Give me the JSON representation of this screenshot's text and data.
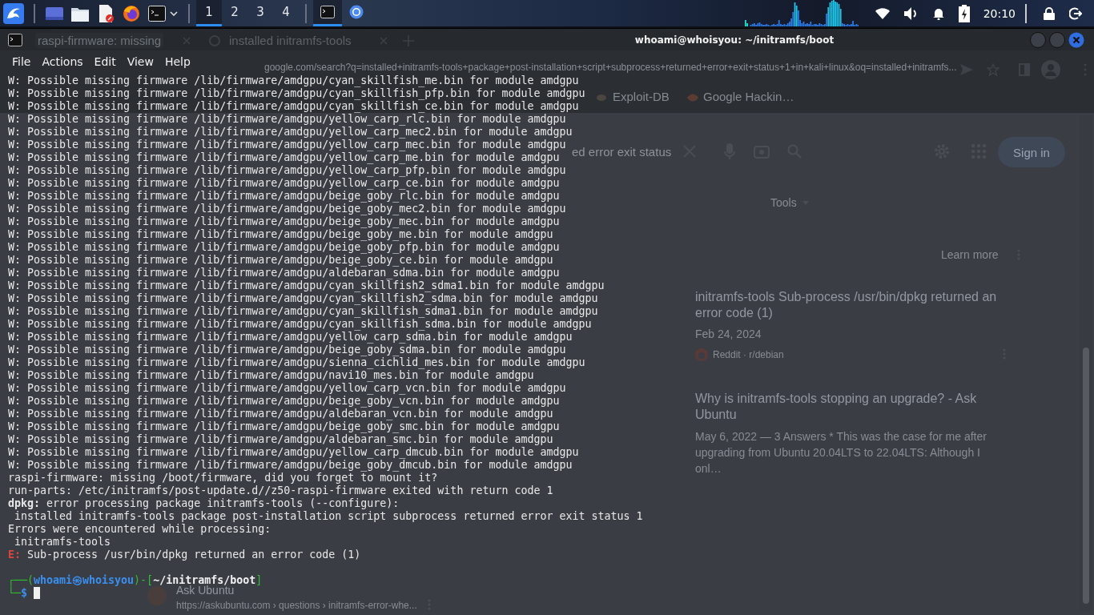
{
  "panel": {
    "workspaces": [
      {
        "label": "1",
        "selected": true
      },
      {
        "label": "2",
        "selected": false
      },
      {
        "label": "3",
        "selected": false
      },
      {
        "label": "4",
        "selected": false
      }
    ],
    "tasks": [
      {
        "kind": "terminal",
        "selected": true
      },
      {
        "kind": "browser",
        "selected": false
      }
    ],
    "clock": "20:10"
  },
  "background_browser": {
    "tabs": [
      {
        "label": "raspi-firmware: missing",
        "selected": true
      },
      {
        "label": "installed initramfs-tools",
        "selected": false
      }
    ],
    "address": "google.com/search?q=installed+initramfs-tools+package+post-installation+script+subprocess+returned+error+exit+status+1+in+kali+linux&oq=installed+initramfs...",
    "bookmarks": [
      "Exploit-DB",
      "Google Hackin…"
    ],
    "search_query": "ed error exit status",
    "sign_in": "Sign in",
    "tools": "Tools",
    "learn_more": "Learn more",
    "results": [
      {
        "title": "initramfs-tools Sub-process /usr/bin/dpkg returned an error code (1)",
        "date": "Feb 24, 2024",
        "source": "Reddit · r/debian"
      },
      {
        "title": "Why is initramfs-tools stopping an upgrade? - Ask Ubuntu",
        "snippet": "May 6, 2022 — 3 Answers * This was the case for me after upgrading from Ubuntu 20.04LTS to 22.04LTS: Although I onl…"
      }
    ],
    "bottom_result": {
      "site": "Ask Ubuntu",
      "url": "https://askubuntu.com › questions › initramfs-error-whe..."
    }
  },
  "terminal": {
    "title": "whoami@whoisyou: ~/initramfs/boot",
    "menu": [
      "File",
      "Actions",
      "Edit",
      "View",
      "Help"
    ],
    "lines": [
      {
        "kind": "plain",
        "text": "W: Possible missing firmware /lib/firmware/amdgpu/cyan_skillfish_me.bin for module amdgpu"
      },
      {
        "kind": "plain",
        "text": "W: Possible missing firmware /lib/firmware/amdgpu/cyan_skillfish_pfp.bin for module amdgpu"
      },
      {
        "kind": "plain",
        "text": "W: Possible missing firmware /lib/firmware/amdgpu/cyan_skillfish_ce.bin for module amdgpu"
      },
      {
        "kind": "plain",
        "text": "W: Possible missing firmware /lib/firmware/amdgpu/yellow_carp_rlc.bin for module amdgpu"
      },
      {
        "kind": "plain",
        "text": "W: Possible missing firmware /lib/firmware/amdgpu/yellow_carp_mec2.bin for module amdgpu"
      },
      {
        "kind": "plain",
        "text": "W: Possible missing firmware /lib/firmware/amdgpu/yellow_carp_mec.bin for module amdgpu"
      },
      {
        "kind": "plain",
        "text": "W: Possible missing firmware /lib/firmware/amdgpu/yellow_carp_me.bin for module amdgpu"
      },
      {
        "kind": "plain",
        "text": "W: Possible missing firmware /lib/firmware/amdgpu/yellow_carp_pfp.bin for module amdgpu"
      },
      {
        "kind": "plain",
        "text": "W: Possible missing firmware /lib/firmware/amdgpu/yellow_carp_ce.bin for module amdgpu"
      },
      {
        "kind": "plain",
        "text": "W: Possible missing firmware /lib/firmware/amdgpu/beige_goby_rlc.bin for module amdgpu"
      },
      {
        "kind": "plain",
        "text": "W: Possible missing firmware /lib/firmware/amdgpu/beige_goby_mec2.bin for module amdgpu"
      },
      {
        "kind": "plain",
        "text": "W: Possible missing firmware /lib/firmware/amdgpu/beige_goby_mec.bin for module amdgpu"
      },
      {
        "kind": "plain",
        "text": "W: Possible missing firmware /lib/firmware/amdgpu/beige_goby_me.bin for module amdgpu"
      },
      {
        "kind": "plain",
        "text": "W: Possible missing firmware /lib/firmware/amdgpu/beige_goby_pfp.bin for module amdgpu"
      },
      {
        "kind": "plain",
        "text": "W: Possible missing firmware /lib/firmware/amdgpu/beige_goby_ce.bin for module amdgpu"
      },
      {
        "kind": "plain",
        "text": "W: Possible missing firmware /lib/firmware/amdgpu/aldebaran_sdma.bin for module amdgpu"
      },
      {
        "kind": "plain",
        "text": "W: Possible missing firmware /lib/firmware/amdgpu/cyan_skillfish2_sdma1.bin for module amdgpu"
      },
      {
        "kind": "plain",
        "text": "W: Possible missing firmware /lib/firmware/amdgpu/cyan_skillfish2_sdma.bin for module amdgpu"
      },
      {
        "kind": "plain",
        "text": "W: Possible missing firmware /lib/firmware/amdgpu/cyan_skillfish_sdma1.bin for module amdgpu"
      },
      {
        "kind": "plain",
        "text": "W: Possible missing firmware /lib/firmware/amdgpu/cyan_skillfish_sdma.bin for module amdgpu"
      },
      {
        "kind": "plain",
        "text": "W: Possible missing firmware /lib/firmware/amdgpu/yellow_carp_sdma.bin for module amdgpu"
      },
      {
        "kind": "plain",
        "text": "W: Possible missing firmware /lib/firmware/amdgpu/beige_goby_sdma.bin for module amdgpu"
      },
      {
        "kind": "plain",
        "text": "W: Possible missing firmware /lib/firmware/amdgpu/sienna_cichlid_mes.bin for module amdgpu"
      },
      {
        "kind": "plain",
        "text": "W: Possible missing firmware /lib/firmware/amdgpu/navi10_mes.bin for module amdgpu"
      },
      {
        "kind": "plain",
        "text": "W: Possible missing firmware /lib/firmware/amdgpu/yellow_carp_vcn.bin for module amdgpu"
      },
      {
        "kind": "plain",
        "text": "W: Possible missing firmware /lib/firmware/amdgpu/beige_goby_vcn.bin for module amdgpu"
      },
      {
        "kind": "plain",
        "text": "W: Possible missing firmware /lib/firmware/amdgpu/aldebaran_vcn.bin for module amdgpu"
      },
      {
        "kind": "plain",
        "text": "W: Possible missing firmware /lib/firmware/amdgpu/beige_goby_smc.bin for module amdgpu"
      },
      {
        "kind": "plain",
        "text": "W: Possible missing firmware /lib/firmware/amdgpu/aldebaran_smc.bin for module amdgpu"
      },
      {
        "kind": "plain",
        "text": "W: Possible missing firmware /lib/firmware/amdgpu/yellow_carp_dmcub.bin for module amdgpu"
      },
      {
        "kind": "plain",
        "text": "W: Possible missing firmware /lib/firmware/amdgpu/beige_goby_dmcub.bin for module amdgpu"
      },
      {
        "kind": "plain",
        "text": "raspi-firmware: missing /boot/firmware, did you forget to mount it?"
      },
      {
        "kind": "plain",
        "text": "run-parts: /etc/initramfs/post-update.d//z50-raspi-firmware exited with return code 1"
      },
      {
        "kind": "rich",
        "text": "**dpkg:** error processing package initramfs-tools (--configure):"
      },
      {
        "kind": "plain",
        "text": " installed initramfs-tools package post-installation script subprocess returned error exit status 1"
      },
      {
        "kind": "plain",
        "text": "Errors were encountered while processing:"
      },
      {
        "kind": "plain",
        "text": " initramfs-tools"
      },
      {
        "kind": "error",
        "prefix": "E:",
        "text": "Sub-process /usr/bin/dpkg returned an error code (1)"
      },
      {
        "kind": "blank"
      }
    ],
    "prompt": {
      "frame_top": "┌──(",
      "user": "whoami",
      "separator": "㉿",
      "host": "whoisyou",
      "middle": ")-[",
      "cwd": "~/initramfs/boot",
      "close": "]",
      "frame_bottom": "└─",
      "symbol": "$"
    }
  }
}
